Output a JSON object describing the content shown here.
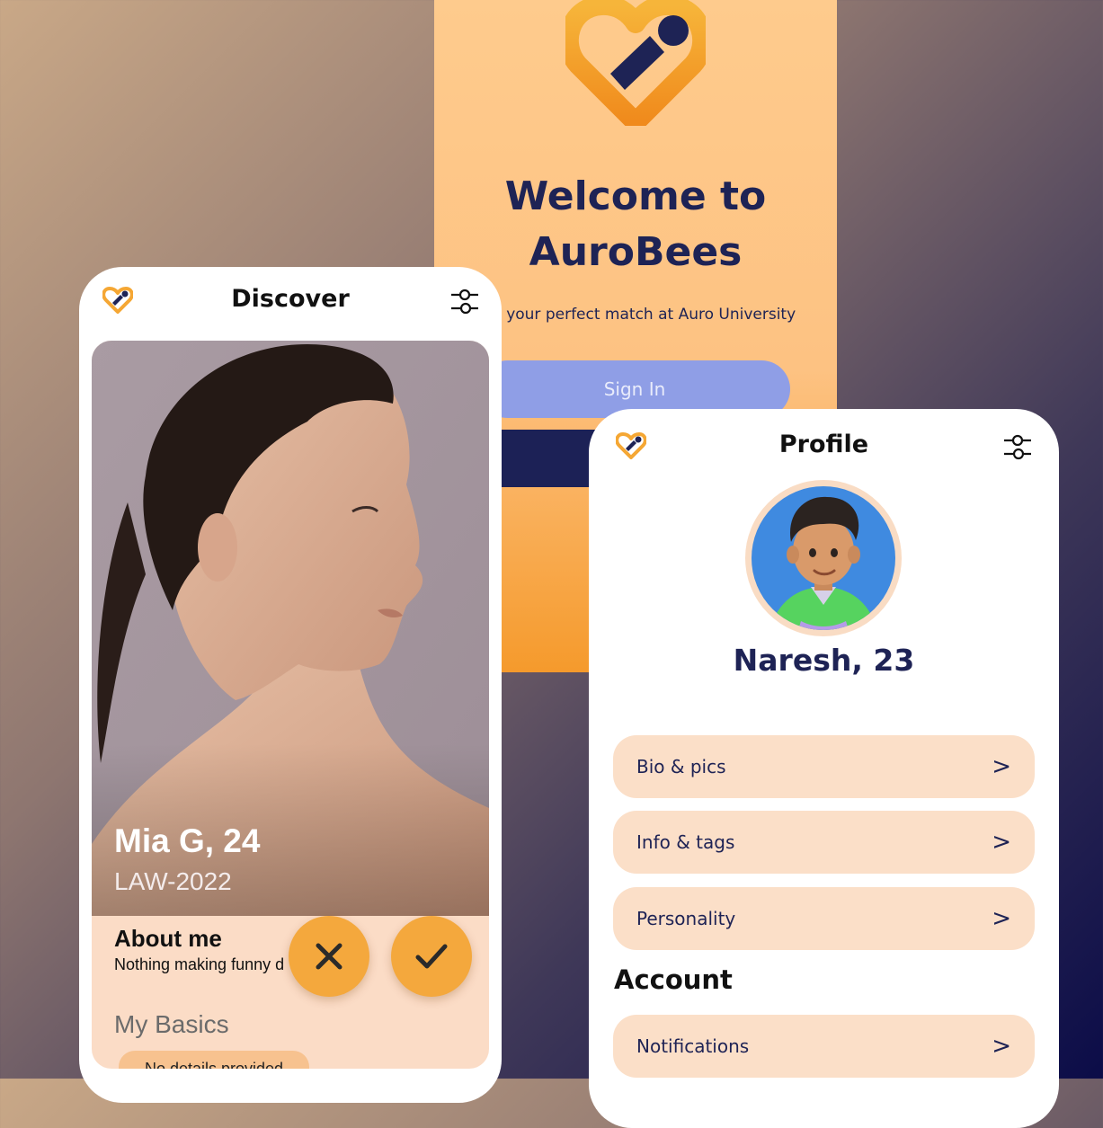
{
  "welcome": {
    "title_line1": "Welcome to",
    "title_line2": "AuroBees",
    "subtitle": "d your perfect match at Auro University",
    "signin_label": "Sign In"
  },
  "discover": {
    "title": "Discover",
    "card": {
      "name": "Mia G, 24",
      "course": "LAW-2022",
      "about_title": "About me",
      "about_text": "Nothing making funny d",
      "basics_title": "My Basics",
      "basics_value": "No details provided"
    }
  },
  "profile": {
    "title": "Profile",
    "name": "Naresh, 23",
    "items": [
      {
        "label": "Bio & pics",
        "chevron": ">"
      },
      {
        "label": "Info & tags",
        "chevron": ">"
      },
      {
        "label": "Personality",
        "chevron": ">"
      }
    ],
    "account_title": "Account",
    "account_items": [
      {
        "label": "Notifications",
        "chevron": ">"
      }
    ]
  },
  "colors": {
    "navy": "#1e2355",
    "accent_orange": "#f4a83d",
    "peach": "#fbdfc8",
    "signin_blue": "#8f9ee6"
  },
  "icons": [
    "heart-logo-icon",
    "filter-sliders-icon",
    "close-icon",
    "check-icon",
    "chevron-right-icon"
  ]
}
